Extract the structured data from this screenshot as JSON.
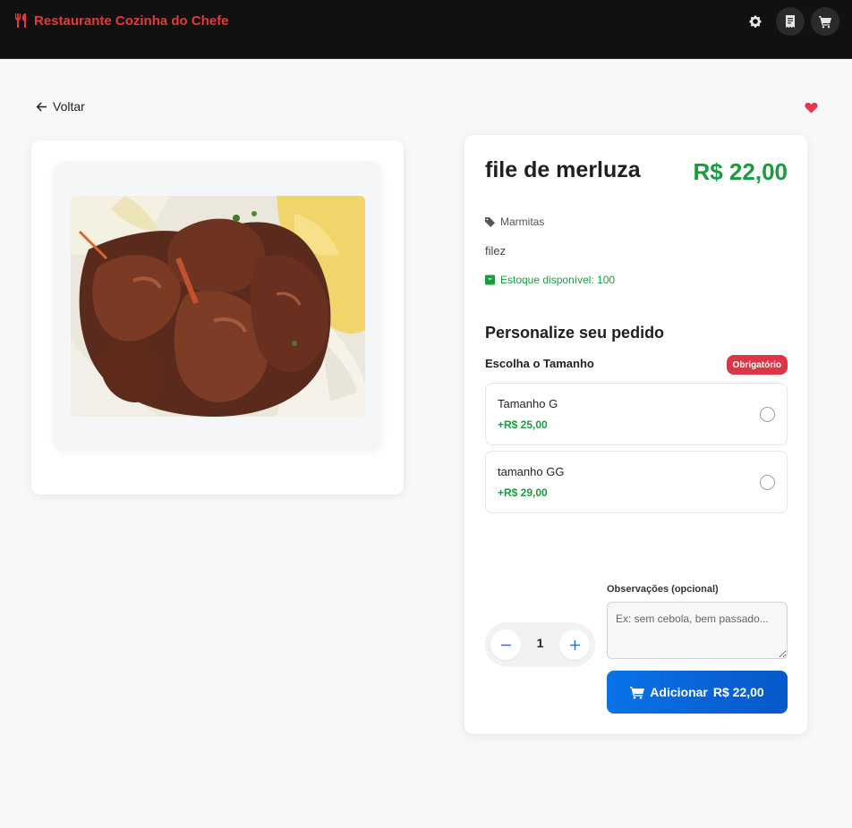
{
  "header": {
    "brand_name": "Restaurante Cozinha do Chefe",
    "brand_icon": "utensils-icon",
    "actions": [
      {
        "icon": "gear-icon"
      },
      {
        "icon": "receipt-icon"
      },
      {
        "icon": "cart-icon"
      }
    ],
    "brand_color": "#e53935",
    "background": "#111111"
  },
  "nav": {
    "back_label": "Voltar",
    "favorite_icon": "heart-icon",
    "favorite_color": "#e5364b"
  },
  "product": {
    "name": "file de merluza",
    "price": "R$ 22,00",
    "category": "Marmitas",
    "description": "filez",
    "stock": "Estoque disponível: 100",
    "image_icon": "food-photo",
    "price_color": "#1a9b3f"
  },
  "customize": {
    "title": "Personalize seu pedido",
    "group_title": "Escolha o Tamanho",
    "required_badge": "Obrigatório",
    "options": [
      {
        "name": "Tamanho G",
        "price": "+R$ 25,00",
        "selected": false
      },
      {
        "name": "tamanho GG",
        "price": "+R$ 29,00",
        "selected": false
      }
    ]
  },
  "order": {
    "observations_label": "Observações (opcional)",
    "observations_placeholder": "Ex: sem cebola, bem passado...",
    "observations_value": "",
    "quantity": "1",
    "add_label": "Adicionar",
    "add_price": "R$ 22,00",
    "button_color": "#0a6ee0"
  }
}
